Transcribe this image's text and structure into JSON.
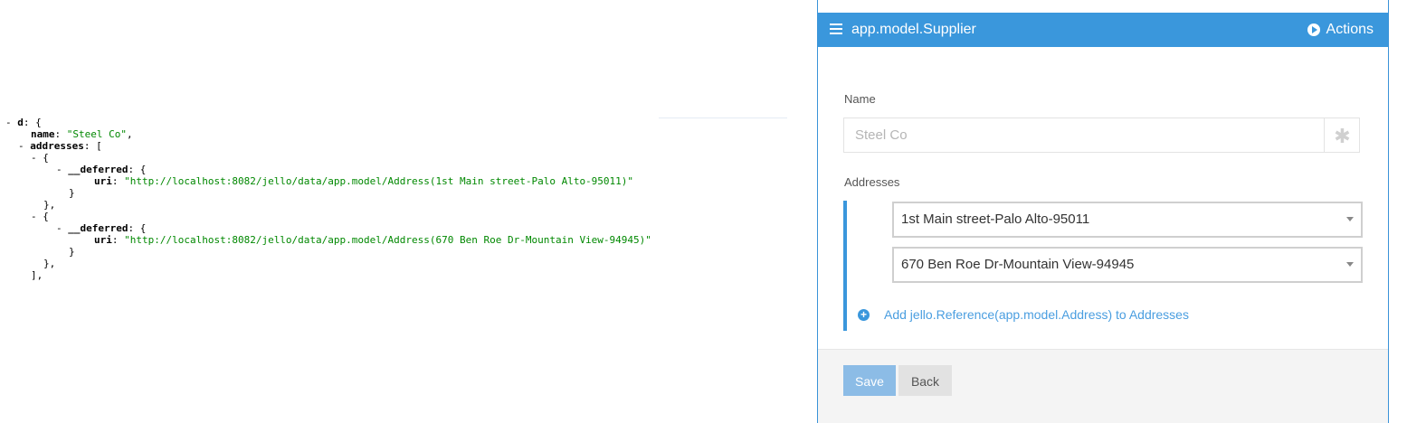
{
  "json_view": {
    "lines": [
      {
        "indent": 0,
        "toggle": "- ",
        "key": "d",
        "tail": ": {"
      },
      {
        "indent": 1,
        "toggle": "",
        "key": "name",
        "mid": ": ",
        "str": "\"Steel Co\"",
        "tail": ","
      },
      {
        "indent": 1,
        "toggle": "- ",
        "key": "addresses",
        "tail": ": ["
      },
      {
        "indent": 2,
        "toggle": "- ",
        "key": "",
        "tail": "{"
      },
      {
        "indent": 3,
        "toggle": "- ",
        "key": "__deferred",
        "tail": ": {"
      },
      {
        "indent": 4,
        "toggle": "",
        "key": "uri",
        "mid": ": ",
        "str": "\"http://localhost:8082/jello/data/app.model/Address(1st Main street-Palo Alto-95011)\"",
        "tail": ""
      },
      {
        "indent": 3,
        "toggle": "",
        "key": "",
        "tail": "}"
      },
      {
        "indent": 2,
        "toggle": "",
        "key": "",
        "tail": "},"
      },
      {
        "indent": 2,
        "toggle": "- ",
        "key": "",
        "tail": "{"
      },
      {
        "indent": 3,
        "toggle": "- ",
        "key": "__deferred",
        "tail": ": {"
      },
      {
        "indent": 4,
        "toggle": "",
        "key": "uri",
        "mid": ": ",
        "str": "\"http://localhost:8082/jello/data/app.model/Address(670 Ben Roe Dr-Mountain View-94945)\"",
        "tail": ""
      },
      {
        "indent": 3,
        "toggle": "",
        "key": "",
        "tail": "}"
      },
      {
        "indent": 2,
        "toggle": "",
        "key": "",
        "tail": "},"
      },
      {
        "indent": 1,
        "toggle": "",
        "key": "",
        "tail": "],"
      }
    ]
  },
  "panel": {
    "title": "app.model.Supplier",
    "actions_label": "Actions",
    "name_label": "Name",
    "name_value": "Steel Co",
    "required_symbol": "✱",
    "addresses_label": "Addresses",
    "addresses": [
      "1st Main street-Palo Alto-95011",
      "670 Ben Roe Dr-Mountain View-94945"
    ],
    "add_link": "Add jello.Reference(app.model.Address) to Addresses",
    "add_symbol": "+",
    "save_label": "Save",
    "back_label": "Back"
  },
  "colors": {
    "header_blue": "#3a97dc",
    "json_string_green": "#008800",
    "save_button": "#8cbce6"
  },
  "icons": [
    "hamburger-icon",
    "play-circle-icon",
    "asterisk-icon",
    "plus-circle-icon",
    "caret-down-icon"
  ]
}
